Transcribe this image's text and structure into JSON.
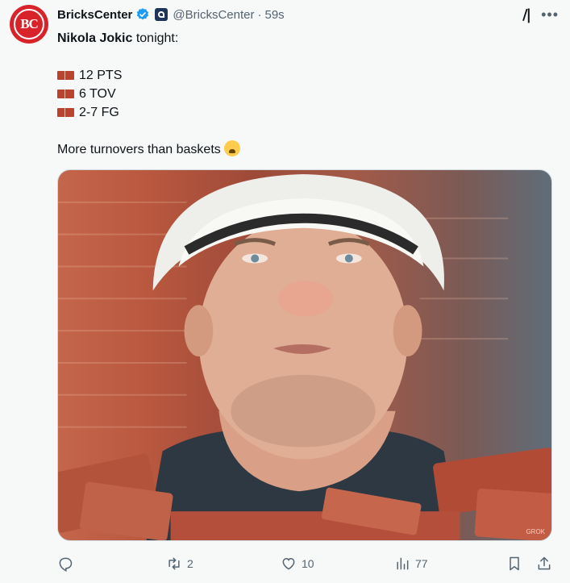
{
  "tweet": {
    "avatar_label": "BC",
    "display_name": "BricksCenter",
    "handle": "@BricksCenter",
    "separator": "·",
    "time": "59s",
    "text": {
      "name": "Nikola Jokic",
      "intro": " tonight:",
      "stats": [
        "12 PTS",
        "6 TOV",
        "2-7 FG"
      ],
      "closing": "More turnovers than baskets"
    },
    "image_alt": "",
    "watermark": "GROK",
    "replies": "",
    "reposts": "2",
    "likes": "10",
    "views": "77"
  },
  "icons": {
    "verified": "verified-badge-icon",
    "affiliate": "affiliate-badge-icon",
    "grok": "grok-icon",
    "more": "more-icon",
    "reply": "reply-icon",
    "repost": "repost-icon",
    "like": "like-icon",
    "views": "views-icon",
    "bookmark": "bookmark-icon",
    "share": "share-icon"
  },
  "colors": {
    "accent": "#1d9bf0",
    "brand": "#d9232a",
    "muted": "#536471"
  }
}
